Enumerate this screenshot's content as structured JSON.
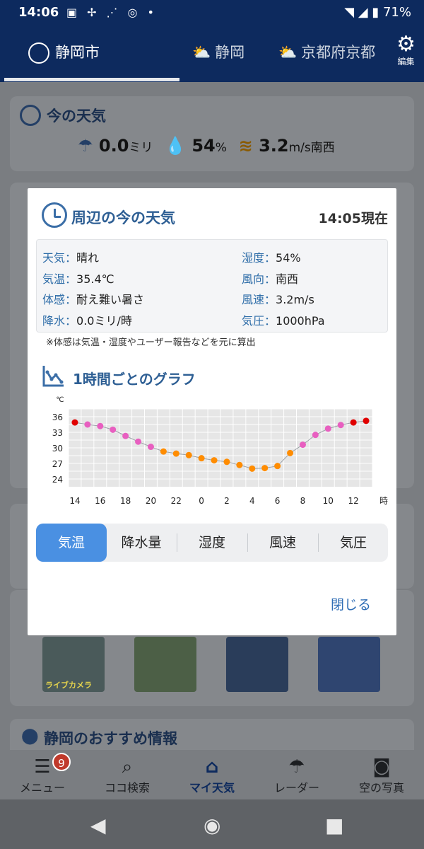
{
  "status": {
    "time": "14:06",
    "battery": "71%"
  },
  "tabs": [
    {
      "label": "静岡市"
    },
    {
      "label": "静岡"
    },
    {
      "label": "京都府京都"
    }
  ],
  "edit_label": "編集",
  "now_weather": {
    "title": "今の天気",
    "rain_value": "0.0",
    "rain_unit": "ミリ",
    "humidity_value": "54",
    "humidity_unit": "%",
    "wind_value": "3.2",
    "wind_unit": "m/s",
    "wind_dir": "南西"
  },
  "bg_misc": {
    "live_camera": "ライブカメラ",
    "recommend_title": "静岡のおすすめ情報"
  },
  "bottom_nav": [
    {
      "label": "メニュー",
      "icon": "menu-icon"
    },
    {
      "label": "ココ検索",
      "icon": "search-icon"
    },
    {
      "label": "マイ天気",
      "icon": "home-icon"
    },
    {
      "label": "レーダー",
      "icon": "radar-umbrella-icon"
    },
    {
      "label": "空の写真",
      "icon": "camera-icon"
    }
  ],
  "menu_badge": "9",
  "modal": {
    "title": "周辺の今の天気",
    "time": "14:05現在",
    "rows_left": [
      {
        "label": "天気：",
        "value": "晴れ"
      },
      {
        "label": "気温：",
        "value": "35.4℃"
      },
      {
        "label": "体感：",
        "value": "耐え難い暑さ"
      },
      {
        "label": "降水：",
        "value": "0.0ミリ/時"
      }
    ],
    "rows_right": [
      {
        "label": "湿度：",
        "value": "54%"
      },
      {
        "label": "風向：",
        "value": "南西"
      },
      {
        "label": "風速：",
        "value": "3.2m/s"
      },
      {
        "label": "気圧：",
        "value": "1000hPa"
      }
    ],
    "note": "※体感は気温・湿度やユーザー報告などを元に算出",
    "graph_title": "1時間ごとのグラフ",
    "segments": [
      "気温",
      "降水量",
      "湿度",
      "風速",
      "気圧"
    ],
    "active_segment": 0,
    "close_label": "閉じる"
  },
  "chart_data": {
    "type": "scatter",
    "y_unit": "℃",
    "x_unit": "時",
    "x_tick_labels": [
      "14",
      "16",
      "18",
      "20",
      "22",
      "0",
      "2",
      "4",
      "6",
      "8",
      "10",
      "12"
    ],
    "y_ticks": [
      24,
      27,
      30,
      33,
      36
    ],
    "ylim": [
      22.5,
      37.5
    ],
    "grid": true,
    "series": [
      {
        "x": [
          "14",
          "15",
          "16",
          "17",
          "18",
          "19",
          "20",
          "21",
          "22",
          "23",
          "0",
          "1",
          "2",
          "3",
          "4",
          "5",
          "6",
          "7",
          "8",
          "9",
          "10",
          "11",
          "12",
          "13"
        ],
        "values": [
          34.9,
          34.5,
          34.2,
          33.5,
          32.3,
          31.2,
          30.2,
          29.3,
          28.9,
          28.6,
          28.0,
          27.6,
          27.3,
          26.7,
          26.0,
          26.1,
          26.5,
          29.0,
          30.6,
          32.5,
          33.7,
          34.4,
          34.9,
          35.2
        ],
        "colors": [
          "#e00000",
          "#e85fc0",
          "#e85fc0",
          "#e85fc0",
          "#e85fc0",
          "#e85fc0",
          "#e85fc0",
          "#ff8c00",
          "#ff8c00",
          "#ff8c00",
          "#ff8c00",
          "#ff8c00",
          "#ff8c00",
          "#ff8c00",
          "#ff8c00",
          "#ff8c00",
          "#ff8c00",
          "#ff8c00",
          "#e85fc0",
          "#e85fc0",
          "#e85fc0",
          "#e85fc0",
          "#e00000",
          "#e00000"
        ]
      }
    ]
  }
}
